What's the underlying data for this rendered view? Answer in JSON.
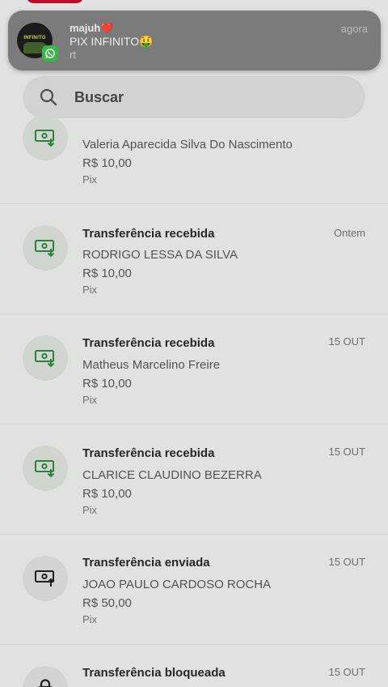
{
  "notification": {
    "sender": "majuh❤️",
    "message": "PIX INFINITO🤑",
    "preview": "rt",
    "time": "agora",
    "avatar_text": "INFINITO",
    "app_icon": "whatsapp-icon"
  },
  "search": {
    "placeholder": "Buscar"
  },
  "transactions": [
    {
      "title": "",
      "name": "Valeria Aparecida Silva Do Nascimento",
      "amount": "R$ 10,00",
      "method": "Pix",
      "date": "",
      "icon": "money-received-icon"
    },
    {
      "title": "Transferência recebida",
      "name": "RODRIGO LESSA DA SILVA",
      "amount": "R$ 10,00",
      "method": "Pix",
      "date": "Ontem",
      "icon": "money-received-icon"
    },
    {
      "title": "Transferência recebida",
      "name": "Matheus Marcelino Freire",
      "amount": "R$ 10,00",
      "method": "Pix",
      "date": "15 OUT",
      "icon": "money-received-icon"
    },
    {
      "title": "Transferência recebida",
      "name": "CLARICE CLAUDINO BEZERRA",
      "amount": "R$ 10,00",
      "method": "Pix",
      "date": "15 OUT",
      "icon": "money-received-icon"
    },
    {
      "title": "Transferência enviada",
      "name": "JOAO PAULO CARDOSO ROCHA",
      "amount": "R$ 50,00",
      "method": "Pix",
      "date": "15 OUT",
      "icon": "money-sent-icon"
    },
    {
      "title": "Transferência bloqueada",
      "name": "",
      "amount": "",
      "method": "",
      "date": "15 OUT",
      "icon": "lock-icon"
    }
  ],
  "colors": {
    "received_icon": "#2e8b3e",
    "sent_icon": "#222222",
    "notification_bg": "#7b7b7b",
    "whatsapp_green": "#3bb54a"
  }
}
